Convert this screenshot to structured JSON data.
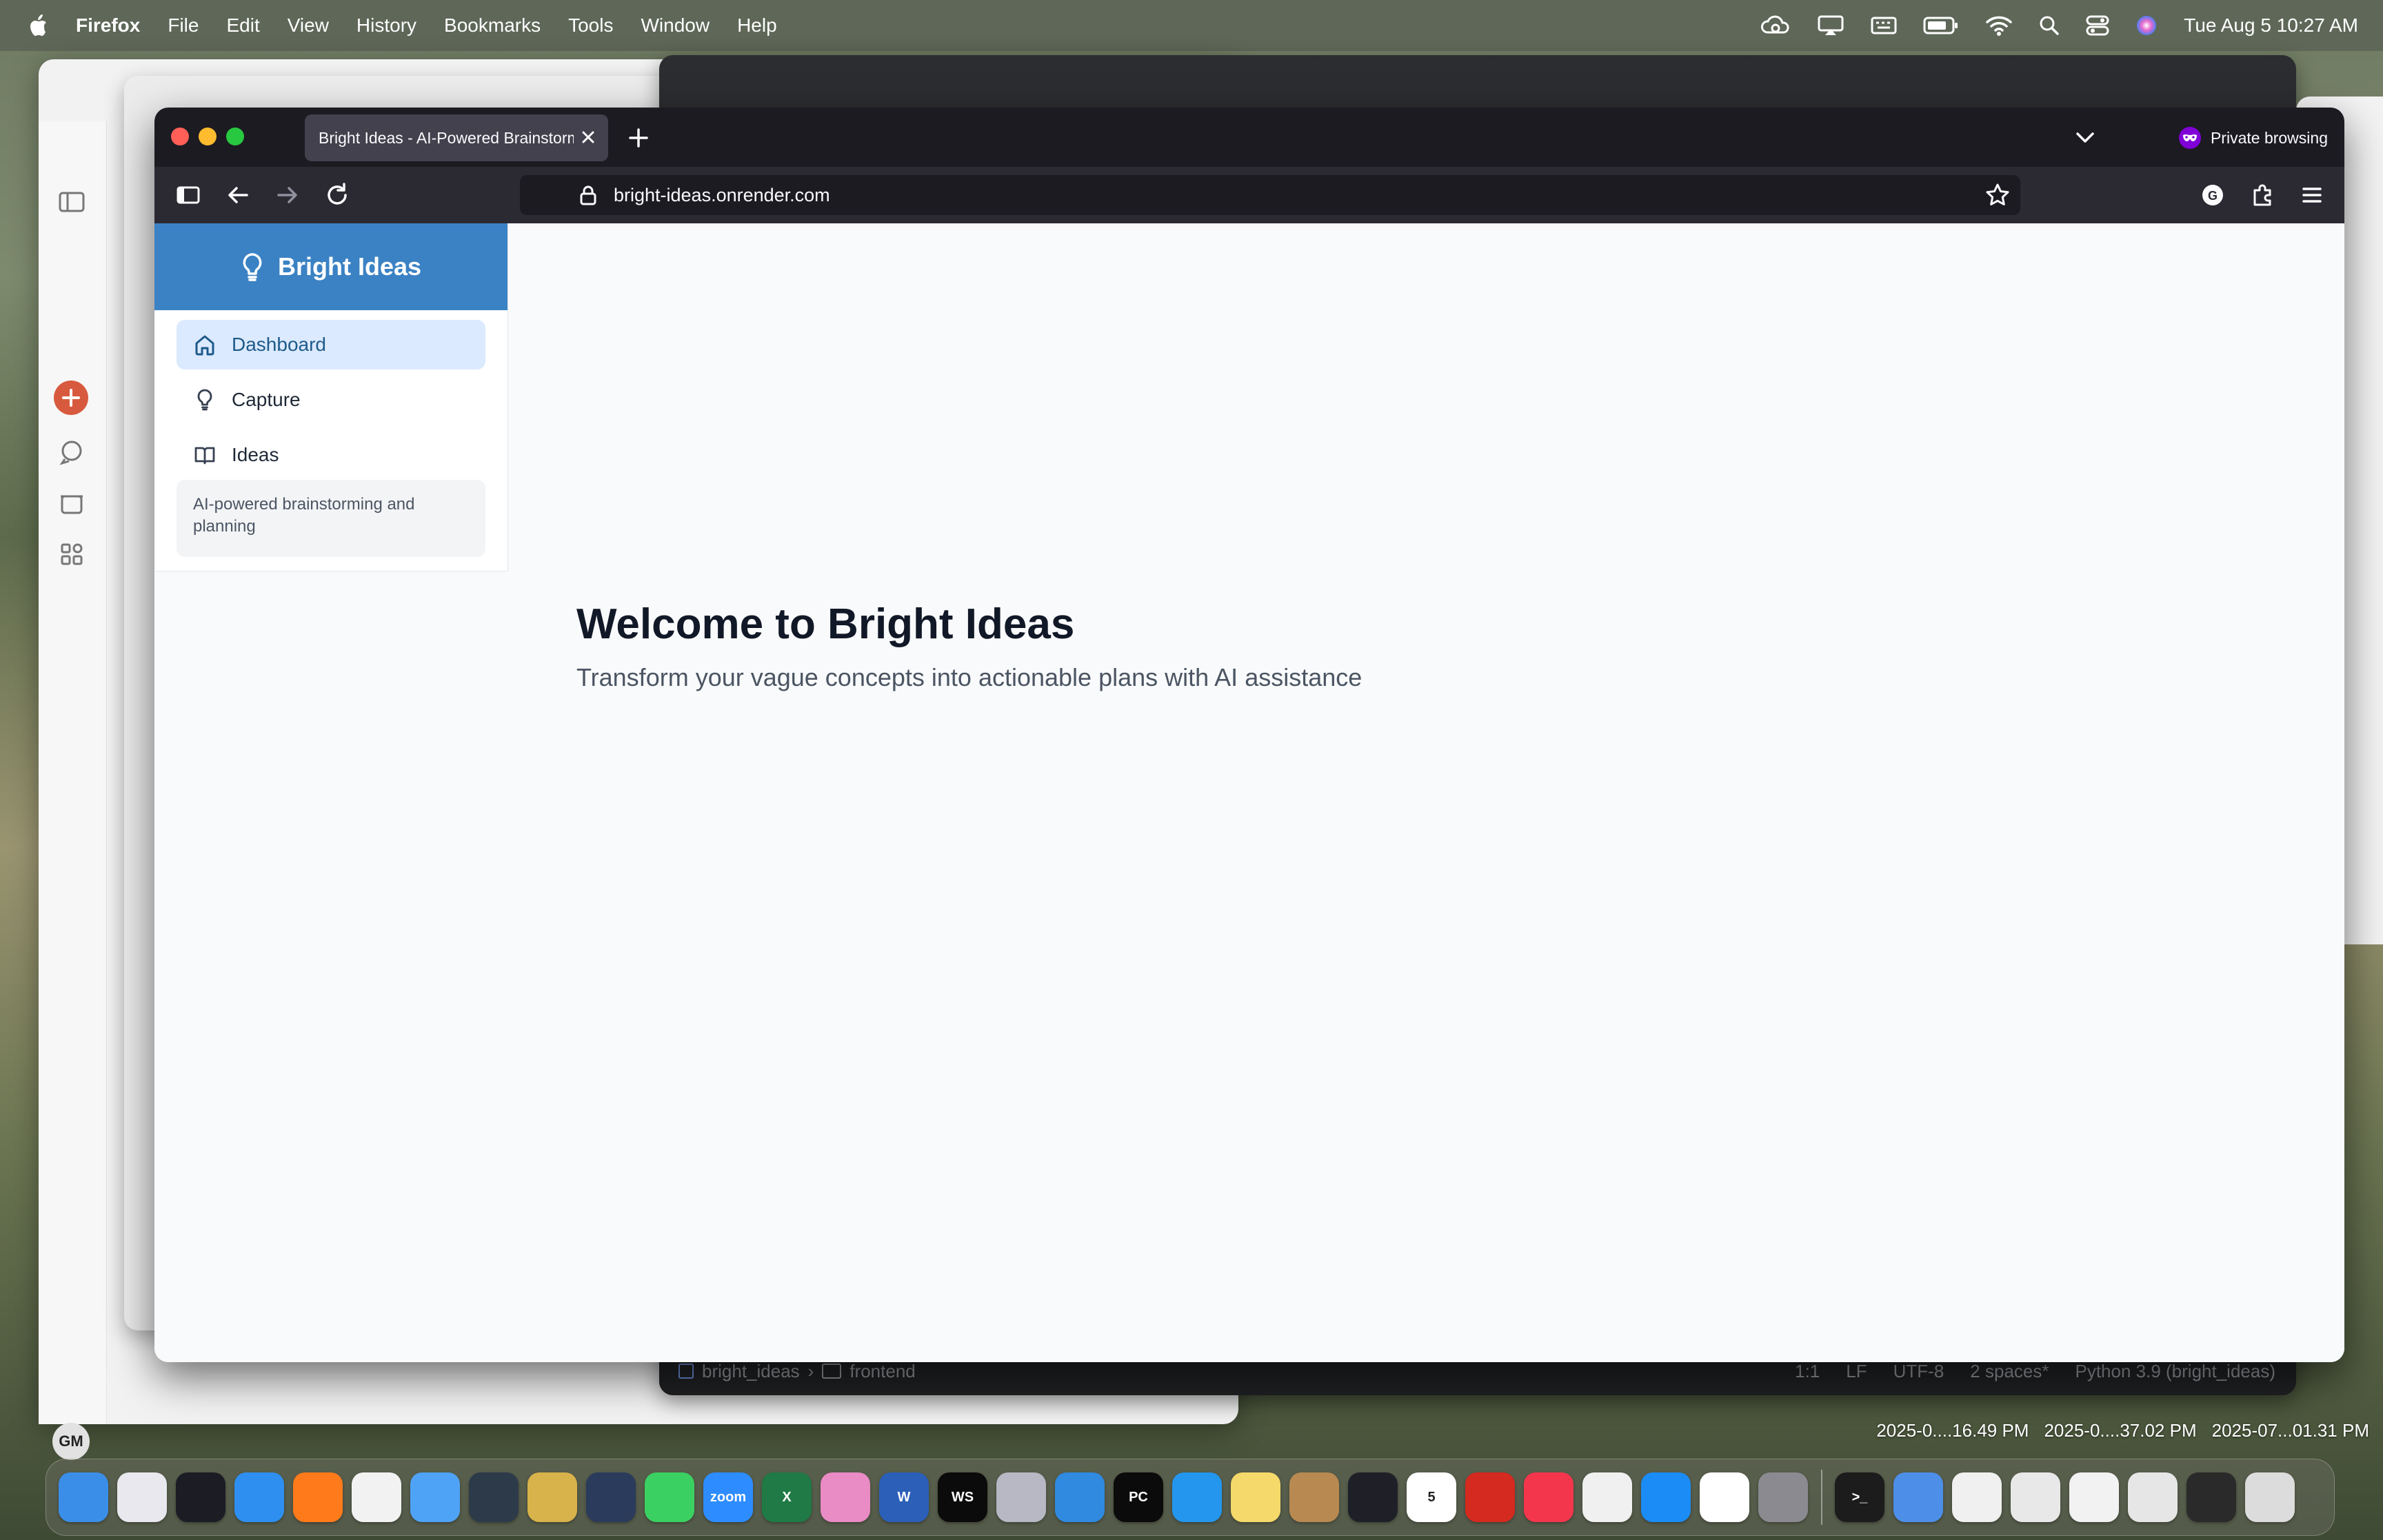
{
  "menubar": {
    "app_name": "Firefox",
    "menus": [
      "File",
      "Edit",
      "View",
      "History",
      "Bookmarks",
      "Tools",
      "Window",
      "Help"
    ],
    "clock": "Tue Aug 5  10:27 AM",
    "status_icons": [
      "cloud-sync-icon",
      "screen-mirror-icon",
      "keyboard-icon",
      "battery-icon",
      "wifi-icon",
      "spotlight-icon",
      "control-center-icon",
      "siri-icon"
    ]
  },
  "browser": {
    "tab_title": "Bright Ideas - AI-Powered Brainstorming",
    "url": "bright-ideas.onrender.com",
    "private_label": "Private browsing"
  },
  "app": {
    "brand": "Bright Ideas",
    "nav": [
      {
        "label": "Dashboard",
        "icon": "home-icon",
        "active": true
      },
      {
        "label": "Capture",
        "icon": "lightbulb-icon",
        "active": false
      },
      {
        "label": "Ideas",
        "icon": "book-icon",
        "active": false
      }
    ],
    "sidebar_footer": "AI-powered brainstorming and planning",
    "welcome_title": "Welcome to Bright Ideas",
    "welcome_subtitle": "Transform your vague concepts into actionable plans with AI assistance"
  },
  "ide_status": {
    "breadcrumb": [
      "bright_ideas",
      "frontend"
    ],
    "items": [
      "1:1",
      "LF",
      "UTF-8",
      "2 spaces*",
      "Python 3.9 (bright_ideas)"
    ]
  },
  "background_left": {
    "avatar": "GM"
  },
  "desktop": {
    "screenshots": [
      "2025-0....16.49 PM",
      "2025-0....37.02 PM",
      "2025-07...01.31 PM"
    ]
  },
  "dock": {
    "apps": [
      {
        "name": "Finder",
        "color": "#3b8ee8"
      },
      {
        "name": "Launchpad",
        "color": "#e8e8ee"
      },
      {
        "name": "Final Cut",
        "color": "#1c1c24"
      },
      {
        "name": "Safari",
        "color": "#2e8ff0"
      },
      {
        "name": "Firefox",
        "color": "#ff7a1a"
      },
      {
        "name": "Chrome",
        "color": "#f2f2f2"
      },
      {
        "name": "Mail",
        "color": "#4fa3f7"
      },
      {
        "name": "DaVinci",
        "color": "#2d3a4a"
      },
      {
        "name": "Cocktail",
        "color": "#d8b24a"
      },
      {
        "name": "Perplexity",
        "color": "#2a3b5c"
      },
      {
        "name": "Messages",
        "color": "#3bd162"
      },
      {
        "name": "Zoom",
        "color": "#2d8cff",
        "label": "zoom"
      },
      {
        "name": "Excel",
        "color": "#1f7a45",
        "label": "X"
      },
      {
        "name": "Pinterest",
        "color": "#e98bc4"
      },
      {
        "name": "Word",
        "color": "#2b5fb8",
        "label": "W"
      },
      {
        "name": "WebStorm",
        "color": "#0b0b0b",
        "label": "WS"
      },
      {
        "name": "Tools",
        "color": "#b8b8c4"
      },
      {
        "name": "VS Code",
        "color": "#2f8ae0"
      },
      {
        "name": "PyCharm",
        "color": "#0b0b0b",
        "label": "PC"
      },
      {
        "name": "Docker",
        "color": "#2496ed"
      },
      {
        "name": "Notes",
        "color": "#f5d96a"
      },
      {
        "name": "Contacts",
        "color": "#b88a52"
      },
      {
        "name": "Activity",
        "color": "#1f1f28"
      },
      {
        "name": "Calendar",
        "color": "#ffffff",
        "label": "5"
      },
      {
        "name": "Acrobat",
        "color": "#d42a20"
      },
      {
        "name": "Music",
        "color": "#f4364c"
      },
      {
        "name": "Photos",
        "color": "#f0f0f0"
      },
      {
        "name": "App Store",
        "color": "#1b8cf5"
      },
      {
        "name": "Kindle",
        "color": "#ffffff"
      },
      {
        "name": "Settings",
        "color": "#8a8a90"
      },
      {
        "name": "Terminal",
        "color": "#1c1c1c",
        "label": ">_"
      },
      {
        "name": "Xcode",
        "color": "#4d8ee8"
      },
      {
        "name": "TextEdit",
        "color": "#f0f0f0"
      },
      {
        "name": "Recent 1",
        "color": "#e8e8e8"
      },
      {
        "name": "Recent 2",
        "color": "#f2f2f2"
      },
      {
        "name": "Recent 3",
        "color": "#e6e6e6"
      },
      {
        "name": "Recent 4",
        "color": "#2a2a2a"
      },
      {
        "name": "Trash",
        "color": "#dcdcdc"
      }
    ]
  },
  "colors": {
    "brand_blue": "#3b82c4",
    "active_nav_bg": "#dbeafe",
    "firefox_toolbar": "#2b2a33",
    "firefox_tabstrip": "#1c1b22",
    "private_purple": "#8000d7"
  }
}
